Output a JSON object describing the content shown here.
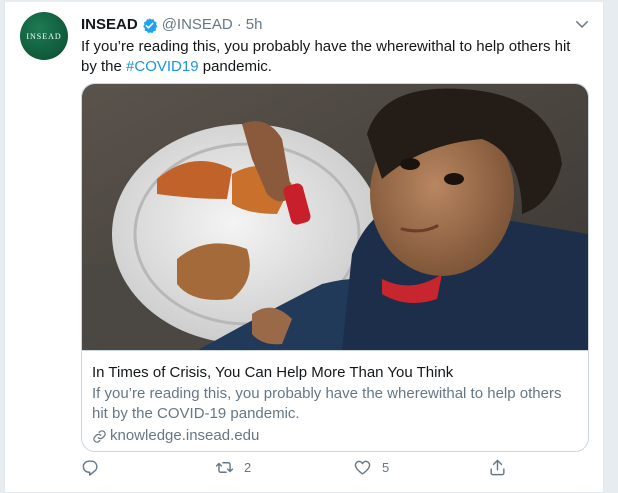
{
  "tweet": {
    "avatar_text": "INSEAD",
    "display_name": "INSEAD",
    "handle": "@INSEAD",
    "separator": "·",
    "time": "5h",
    "text_before": "If you’re reading this, you probably have the wherewithal to help others hit by the ",
    "hashtag": "#COVID19",
    "text_after": " pandemic."
  },
  "card": {
    "title": "In Times of Crisis, You Can Help More Than You Think",
    "description": "If you’re reading this, you probably have the wherewithal to help others hit by the COVID-19 pandemic.",
    "domain": "knowledge.insead.edu"
  },
  "actions": {
    "reply_count": "",
    "retweet_count": "2",
    "like_count": "5"
  },
  "colors": {
    "accent": "#1da1f2",
    "hashtag": "#1b95e0",
    "secondary_text": "#657786",
    "avatar_green": "#0f5a3b"
  },
  "icons": [
    "verified-icon",
    "chevron-down-icon",
    "link-icon",
    "reply-icon",
    "retweet-icon",
    "like-icon",
    "share-icon"
  ]
}
